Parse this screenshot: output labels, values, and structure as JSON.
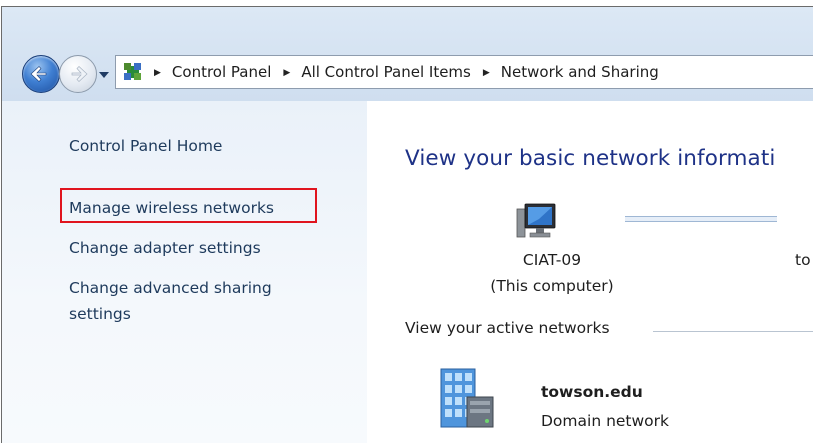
{
  "breadcrumb": {
    "items": [
      "Control Panel",
      "All Control Panel Items",
      "Network and Sharing"
    ]
  },
  "sidebar": {
    "items": [
      {
        "label": "Control Panel Home"
      },
      {
        "label": "Manage wireless networks"
      },
      {
        "label": "Change adapter settings"
      },
      {
        "label": "Change advanced sharing"
      },
      {
        "label": "settings"
      }
    ]
  },
  "main": {
    "title": "View your basic network informati",
    "computer_name": "CIAT-09",
    "computer_sub": "(This computer)",
    "right_cut": "to",
    "active_label": "View your active networks",
    "network": {
      "name": "towson.edu",
      "type": "Domain network"
    }
  },
  "colors": {
    "highlight": "#e0141e",
    "title": "#1e3287",
    "link": "#1e3a5c"
  },
  "icons": {
    "back": "back-arrow-icon",
    "forward": "forward-arrow-icon",
    "dropdown": "chevron-down-icon",
    "address": "control-panel-icon",
    "computer": "computer-icon",
    "network": "network-building-icon"
  }
}
